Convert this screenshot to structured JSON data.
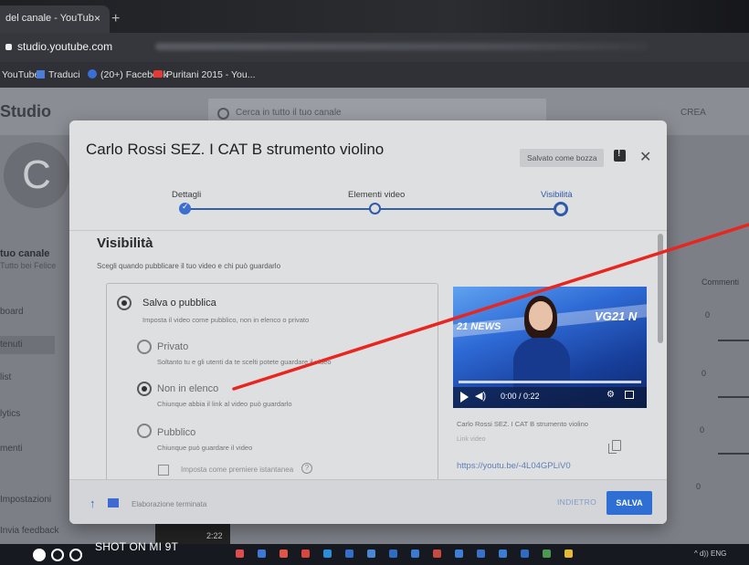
{
  "browser": {
    "tab_title": "del canale - YouTub",
    "tab_close": "×",
    "new_tab": "+",
    "url": "studio.youtube.com",
    "bookmarks": [
      "YouTube",
      "Traduci",
      "(20+) Facebook",
      "Puritani 2015 - You..."
    ]
  },
  "studio": {
    "logo": "Studio",
    "search_placeholder": "Cerca in tutto il tuo canale",
    "header_right": "CREA",
    "avatar_letter": "C",
    "channel_label": "tuo canale",
    "channel_sub": "Tutto bei Felice",
    "nav": [
      "board",
      "tenuti",
      "list",
      "lytics",
      "menti",
      "zelti"
    ],
    "column_header": "Commenti",
    "column_values": [
      "0",
      "0",
      "0",
      "0"
    ],
    "bottom_items": [
      "Impostazioni",
      "Invia feedback"
    ],
    "thumb_time": "2:22"
  },
  "modal": {
    "title": "Carlo Rossi SEZ. I CAT B strumento violino",
    "draft_badge": "Salvato come bozza",
    "steps": [
      {
        "label": "Dettagli",
        "state": "done"
      },
      {
        "label": "Elementi video",
        "state": "pending"
      },
      {
        "label": "Visibilità",
        "state": "active"
      }
    ],
    "visibility_title": "Visibilità",
    "visibility_desc": "Scegli quando pubblicare il tuo video e chi può guardarlo",
    "save_or_publish": {
      "label": "Salva o pubblica",
      "sub": "Imposta il video come pubblico, non in elenco o privato",
      "selected": true
    },
    "options": [
      {
        "label": "Privato",
        "sub": "Soltanto tu e gli utenti da te scelti potete guardare il video",
        "selected": false
      },
      {
        "label": "Non in elenco",
        "sub": "Chiunque abbia il link al video può guardarlo",
        "selected": true
      },
      {
        "label": "Pubblico",
        "sub": "Chiunque può guardare il video",
        "selected": false
      }
    ],
    "premiere_checkbox": "Imposta come premiere istantanea",
    "preview": {
      "logo_left": "21 NEWS",
      "logo_right": "VG21 N",
      "time": "0:00 / 0:22",
      "caption": "Carlo Rossi SEZ. I CAT B strumento violino",
      "link_label": "Link video",
      "link": "https://youtu.be/-4L04GPLiV0"
    },
    "footer": {
      "processing": "Elaborazione terminata",
      "back": "INDIETRO",
      "save": "SALVA"
    }
  },
  "taskbar": {
    "watermark": "SHOT ON MI 9T",
    "tray": "^ d)) ENG"
  },
  "colors": {
    "accent": "#2f6fd4",
    "annotation": "#e8261f"
  }
}
